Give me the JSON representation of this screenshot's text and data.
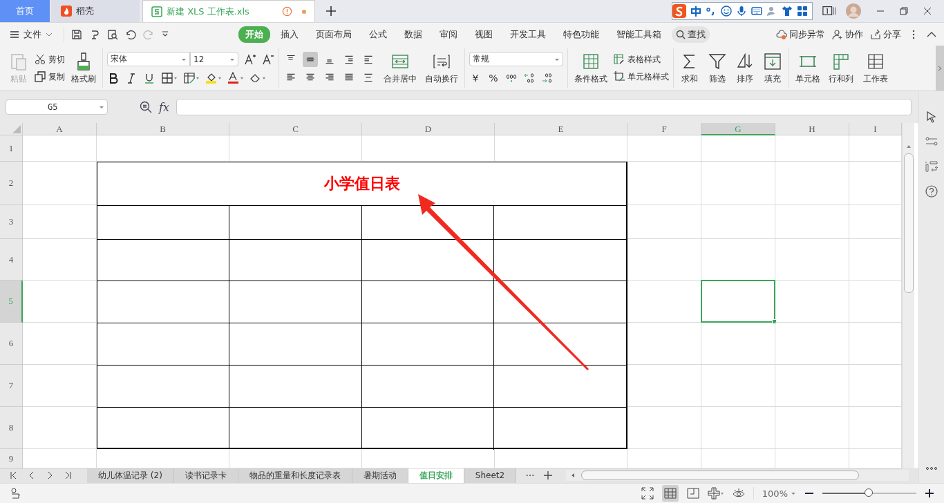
{
  "title_bar": {
    "home_tab": "首页",
    "docer_tab": "稻壳",
    "document_tab": {
      "title": "新建 XLS 工作表.xls",
      "unsaved": true
    }
  },
  "menu_bar": {
    "file": "文件",
    "tabs": [
      {
        "label": "开始",
        "selected": true
      },
      {
        "label": "插入",
        "selected": false
      },
      {
        "label": "页面布局",
        "selected": false
      },
      {
        "label": "公式",
        "selected": false
      },
      {
        "label": "数据",
        "selected": false
      },
      {
        "label": "审阅",
        "selected": false
      },
      {
        "label": "视图",
        "selected": false
      },
      {
        "label": "开发工具",
        "selected": false
      },
      {
        "label": "特色功能",
        "selected": false
      },
      {
        "label": "智能工具箱",
        "selected": false
      }
    ],
    "search": "查找",
    "sync": "同步异常",
    "collaborate": "协作",
    "share": "分享"
  },
  "ribbon": {
    "paste": "粘贴",
    "cut": "剪切",
    "copy": "复制",
    "format_painter": "格式刷",
    "font": "宋体",
    "font_size": "12",
    "align_buttons": [
      {
        "kind": "top",
        "selected": false
      },
      {
        "kind": "middle",
        "selected": true
      },
      {
        "kind": "bottom",
        "selected": false
      },
      {
        "kind": "outdent",
        "selected": false
      },
      {
        "kind": "indent",
        "selected": false
      },
      {
        "kind": "left",
        "selected": false
      },
      {
        "kind": "center",
        "selected": false
      },
      {
        "kind": "right",
        "selected": false
      },
      {
        "kind": "justify",
        "selected": false
      },
      {
        "kind": "distributed",
        "selected": false
      }
    ],
    "merge": "合并居中",
    "wrap": "自动换行",
    "number_format": "常规",
    "currency": "¥",
    "percent": "%",
    "conditional_format": "条件格式",
    "table_style": "表格样式",
    "cell_style": "单元格样式",
    "sum": "求和",
    "filter": "筛选",
    "sort": "排序",
    "fill": "填充",
    "cell": "单元格",
    "rows_columns": "行和列",
    "worksheet": "工作表"
  },
  "formula_bar": {
    "name_box": "G5",
    "fx": "fx"
  },
  "sheet": {
    "columns": [
      {
        "label": "A",
        "selected": false
      },
      {
        "label": "B",
        "selected": false
      },
      {
        "label": "C",
        "selected": false
      },
      {
        "label": "D",
        "selected": false
      },
      {
        "label": "E",
        "selected": false
      },
      {
        "label": "F",
        "selected": false
      },
      {
        "label": "G",
        "selected": true
      },
      {
        "label": "H",
        "selected": false
      },
      {
        "label": "I",
        "selected": false
      }
    ],
    "rows": [
      {
        "label": "1",
        "selected": false
      },
      {
        "label": "2",
        "selected": false
      },
      {
        "label": "3",
        "selected": false
      },
      {
        "label": "4",
        "selected": false
      },
      {
        "label": "5",
        "selected": true
      },
      {
        "label": "6",
        "selected": false
      },
      {
        "label": "7",
        "selected": false
      },
      {
        "label": "8",
        "selected": false
      },
      {
        "label": "9",
        "selected": false
      }
    ],
    "table_title": "小学值日表"
  },
  "sheet_tabs": [
    {
      "label": "幼儿体温记录 (2)",
      "selected": false
    },
    {
      "label": "读书记录卡",
      "selected": false
    },
    {
      "label": "物品的重量和长度记录表",
      "selected": false
    },
    {
      "label": "暑期活动",
      "selected": false
    },
    {
      "label": "值日安排",
      "selected": true
    },
    {
      "label": "Sheet2",
      "selected": false
    }
  ],
  "status_bar": {
    "zoom": "100%",
    "zoom_slider": {
      "level": 0.5
    }
  }
}
